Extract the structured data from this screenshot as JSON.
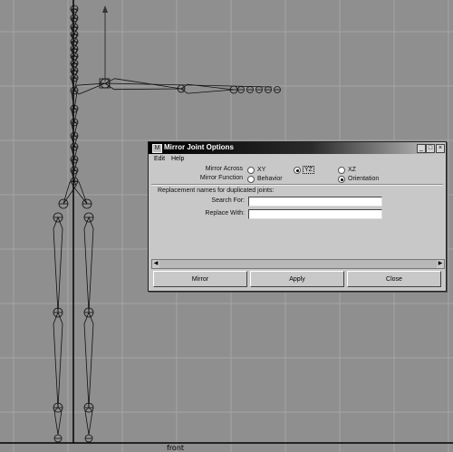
{
  "viewport": {
    "label": "front"
  },
  "dialog": {
    "title": "Mirror Joint Options",
    "app_icon": "maya-icon",
    "window_buttons": [
      "minimize-icon",
      "maximize-icon",
      "close-icon"
    ],
    "window_glyphs": {
      "minimize": "_",
      "maximize": "□",
      "close": "×"
    },
    "menu": {
      "edit": "Edit",
      "help": "Help"
    },
    "mirror_across": {
      "label": "Mirror Across",
      "options": [
        "XY",
        "YZ",
        "XZ"
      ],
      "selected": "YZ"
    },
    "mirror_function": {
      "label": "Mirror Function",
      "options": [
        "Behavior",
        "Orientation"
      ],
      "selected": "Orientation"
    },
    "replacement": {
      "heading": "Replacement names for duplicated joints:",
      "search_label": "Search For:",
      "search_value": "",
      "replace_label": "Replace With:",
      "replace_value": ""
    },
    "buttons": {
      "mirror": "Mirror",
      "apply": "Apply",
      "close": "Close"
    }
  }
}
